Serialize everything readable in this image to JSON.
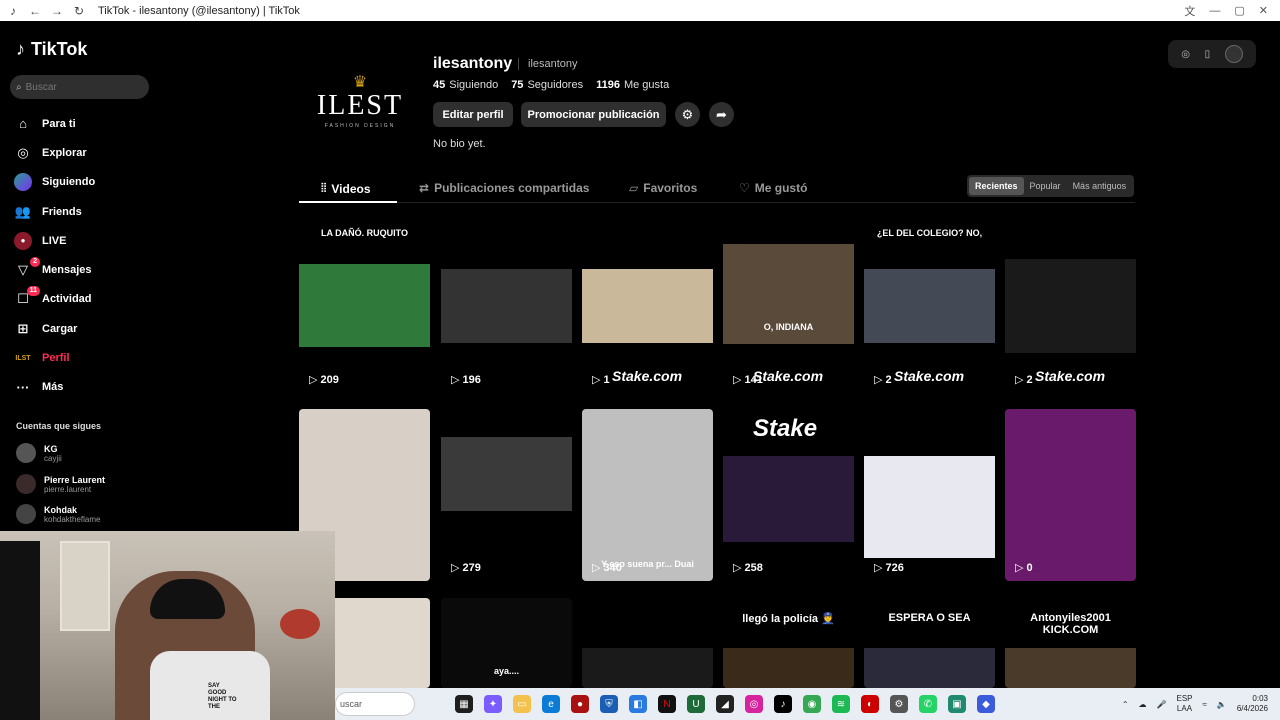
{
  "browser": {
    "title": "TikTok - ilesantony (@ilesantony) | TikTok"
  },
  "sidebar": {
    "logo": "TikTok",
    "search_placeholder": "Buscar",
    "items": [
      {
        "label": "Para ti",
        "icon": "home-icon"
      },
      {
        "label": "Explorar",
        "icon": "compass-icon"
      },
      {
        "label": "Siguiendo",
        "icon": "following-avatar-icon"
      },
      {
        "label": "Friends",
        "icon": "friends-icon"
      },
      {
        "label": "LIVE",
        "icon": "live-icon"
      },
      {
        "label": "Mensajes",
        "icon": "messages-icon",
        "badge": "2"
      },
      {
        "label": "Actividad",
        "icon": "activity-icon",
        "badge": "11"
      },
      {
        "label": "Cargar",
        "icon": "upload-icon"
      },
      {
        "label": "Perfil",
        "icon": "profile-icon",
        "active": true
      },
      {
        "label": "Más",
        "icon": "more-icon"
      }
    ],
    "following_title": "Cuentas que sigues",
    "accounts": [
      {
        "name": "KG",
        "handle": "cayjii"
      },
      {
        "name": "Pierre Laurent",
        "handle": "pierre.laurent"
      },
      {
        "name": "Kohdak",
        "handle": "kohdaktheflame"
      }
    ]
  },
  "profile": {
    "avatar_main": "ILEST",
    "avatar_sub": "FASHION DESIGN",
    "username": "ilesantony",
    "handle": "ilesantony",
    "stats": {
      "following_count": "45",
      "following_label": "Siguiendo",
      "followers_count": "75",
      "followers_label": "Seguidores",
      "likes_count": "1196",
      "likes_label": "Me gusta"
    },
    "edit_button": "Editar perfil",
    "promote_button": "Promocionar publicación",
    "bio": "No bio yet."
  },
  "tabs": [
    {
      "label": "Videos",
      "icon": "grid-icon",
      "active": true
    },
    {
      "label": "Publicaciones compartidas",
      "icon": "repost-icon"
    },
    {
      "label": "Favoritos",
      "icon": "bookmark-icon"
    },
    {
      "label": "Me gustó",
      "icon": "liked-icon"
    }
  ],
  "sort": [
    "Recientes",
    "Popular",
    "Más antiguos"
  ],
  "videos": [
    {
      "views": "209",
      "caption": "LA DAÑÓ. RUQUITO",
      "thumb_color": "#2f7a3b"
    },
    {
      "views": "196",
      "caption": "",
      "thumb_color": "#333333"
    },
    {
      "views": "1",
      "caption": "",
      "thumb_color": "#c9b89a",
      "stake": "Stake.com"
    },
    {
      "views": "141",
      "caption": "",
      "thumb_color": "#5a4a3a",
      "overlay": "O, INDIANA",
      "stake": "Stake.com"
    },
    {
      "views": "2",
      "caption": "¿EL DEL COLEGIO? NO,",
      "thumb_color": "#444a55",
      "stake": "Stake.com"
    },
    {
      "views": "2",
      "caption": "",
      "thumb_color": "#1a1a1a",
      "stake": "Stake.com"
    },
    {
      "views": "",
      "caption": "",
      "thumb_color": "#d8d0c6"
    },
    {
      "views": "279",
      "caption": "",
      "thumb_color": "#3a3a3a"
    },
    {
      "views": "340",
      "caption": "",
      "thumb_color": "#bfbfbf",
      "overlay": "Y eso suena pr... Duai"
    },
    {
      "views": "258",
      "caption": "",
      "thumb_color": "#2a1a3a",
      "stake": "Stake"
    },
    {
      "views": "726",
      "caption": "",
      "thumb_color": "#e8e8f0"
    },
    {
      "views": "0",
      "caption": "",
      "thumb_color": "#6a1a6a"
    },
    {
      "views": "",
      "caption": "",
      "thumb_color": "#e0d8cc"
    },
    {
      "views": "",
      "caption": "",
      "thumb_color": "#0a0a0a",
      "overlay": "aya...."
    },
    {
      "views": "",
      "caption": "",
      "thumb_color": "#1a1a1a"
    },
    {
      "views": "",
      "caption": "llegó la policía 👮",
      "thumb_color": "#3a2a1a"
    },
    {
      "views": "",
      "caption": "ESPERA O SEA",
      "thumb_color": "#2a2a3a"
    },
    {
      "views": "",
      "caption": "Antonyiles2001 KICK.COM",
      "thumb_color": "#4a3a2a"
    }
  ],
  "webcam": {
    "shirt_text": "SAY GOOD NIGHT TO THE"
  },
  "taskbar": {
    "search_placeholder": "uscar",
    "lang_top": "ESP",
    "lang_bottom": "LAA",
    "time": "0:03",
    "date": "6/4/2026"
  }
}
